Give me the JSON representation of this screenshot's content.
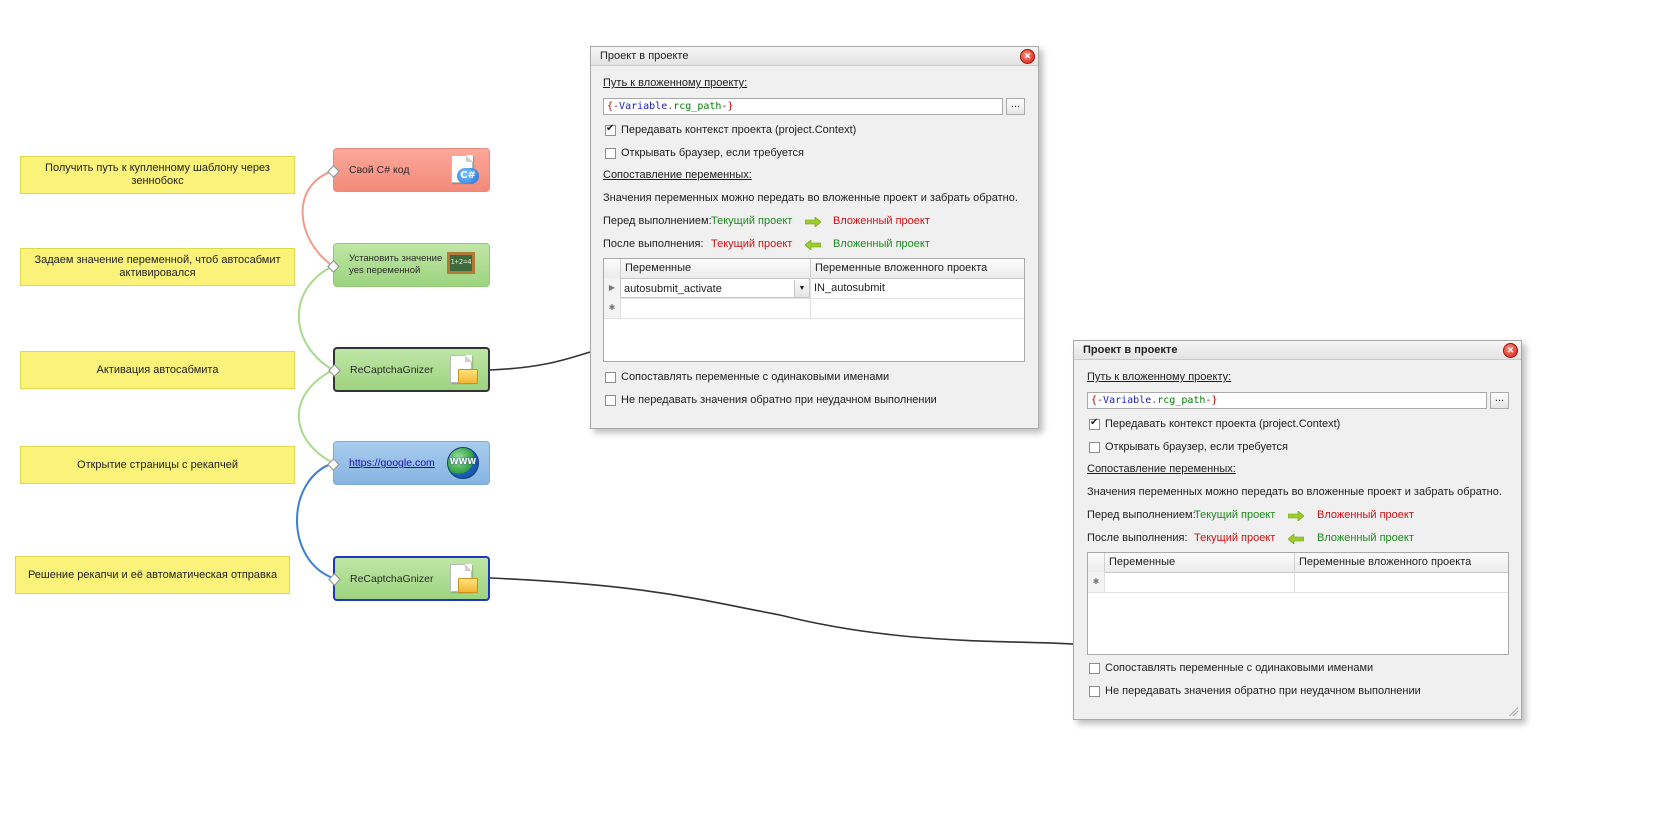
{
  "notes": [
    "Получить путь к купленному шаблону через зеннобокс",
    "Задаем значение переменной, чтоб автосабмит активировался",
    "Активация автосабмита",
    "Открытие страницы с рекапчей",
    "Решение рекапчи и её автоматическая отправка"
  ],
  "nodes": {
    "csharp": {
      "label": "Свой C# код",
      "icon_text": "C#"
    },
    "set_value": {
      "label": "Установить значение yes переменной",
      "icon_text": "1+2=4"
    },
    "recaptcha1": {
      "label": "ReCaptchaGnizer"
    },
    "google": {
      "label": "https://google.com",
      "icon_text": "WWW"
    },
    "recaptcha2": {
      "label": "ReCaptchaGnizer"
    }
  },
  "dialog1": {
    "title": "Проект в проекте",
    "path_label": "Путь к вложенному проекту:",
    "path": {
      "open": "{-",
      "kw": "Variable",
      "dot": ".",
      "var": "rcg_path",
      "close": "-}"
    },
    "browse": "...",
    "pass_context": {
      "label": "Передавать контекст проекта (project.Context)",
      "checked": true
    },
    "open_browser": {
      "label": "Открывать браузер, если требуется",
      "checked": false
    },
    "mapping_label": "Сопоставление переменных:",
    "mapping_desc": "Значения переменных можно передать во вложенные проект и забрать обратно.",
    "before_label": "Перед выполнением:",
    "after_label": "После выполнения:",
    "current_project": "Текущий проект",
    "nested_project": "Вложенный проект",
    "grid_headers": [
      "Переменные",
      "Переменные вложенного проекта"
    ],
    "rows": [
      {
        "var": "autosubmit_activate",
        "nested": "IN_autosubmit"
      }
    ],
    "match_same": {
      "label": "Сопоставлять переменные с одинаковыми именами",
      "checked": false
    },
    "no_return": {
      "label": "Не передавать значения обратно при неудачном выполнении",
      "checked": false
    }
  },
  "dialog2": {
    "title": "Проект в проекте",
    "path_label": "Путь к вложенному проекту:",
    "path": {
      "open": "{-",
      "kw": "Variable",
      "dot": ".",
      "var": "rcg_path",
      "close": "-}"
    },
    "browse": "...",
    "pass_context": {
      "label": "Передавать контекст проекта (project.Context)",
      "checked": true
    },
    "open_browser": {
      "label": "Открывать браузер, если требуется",
      "checked": false
    },
    "mapping_label": "Сопоставление переменных:",
    "mapping_desc": "Значения переменных можно передать во вложенные проект и забрать обратно.",
    "before_label": "Перед выполнением:",
    "after_label": "После выполнения:",
    "current_project": "Текущий проект",
    "nested_project": "Вложенный проект",
    "grid_headers": [
      "Переменные",
      "Переменные вложенного проекта"
    ],
    "rows": [],
    "match_same": {
      "label": "Сопоставлять переменные с одинаковыми именами",
      "checked": false
    },
    "no_return": {
      "label": "Не передавать значения обратно при неудачном выполнении",
      "checked": false
    }
  },
  "colors": {
    "note_bg": "#fbf27a",
    "node_red": "#f38a7a",
    "node_green": "#9dd47f",
    "node_blue": "#86b4e2",
    "link_red": "#f39a8a",
    "link_green": "#a6db8a",
    "link_blue": "#3b7fd0",
    "current_project": "#cc1111",
    "nested_project": "#1c8a1c"
  }
}
